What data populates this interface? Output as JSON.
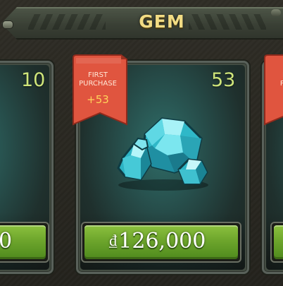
{
  "header": {
    "title": "GEM"
  },
  "cards": [
    {
      "amount": "10",
      "price": "0"
    },
    {
      "amount": "53",
      "ribbon": {
        "line1": "FIRST",
        "line2": "PURCHASE",
        "bonus": "+53"
      },
      "price_symbol": "₫",
      "price": "126,000",
      "icon": "gem-cluster-icon"
    },
    {
      "ribbon": {
        "line1": "FIRST",
        "line2": "PURCH",
        "bonus": "+"
      }
    }
  ],
  "colors": {
    "title": "#f2dc84",
    "amount": "#cfe57a",
    "ribbon": "#e0553f",
    "button_green": "#6da52c",
    "gem": "#4fd3e0"
  }
}
